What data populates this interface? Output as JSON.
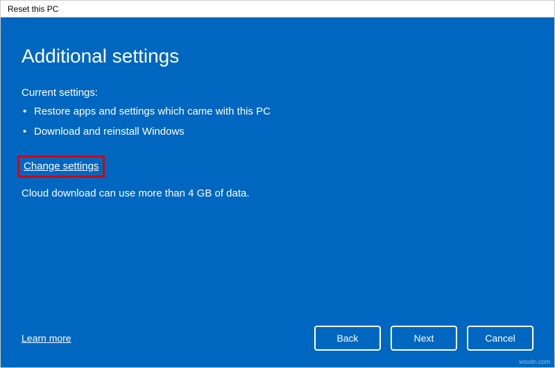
{
  "window": {
    "title": "Reset this PC"
  },
  "page": {
    "heading": "Additional settings",
    "current_settings_label": "Current settings:",
    "bullets": [
      "Restore apps and settings which came with this PC",
      "Download and reinstall Windows"
    ],
    "change_settings_link": "Change settings",
    "note": "Cloud download can use more than 4 GB of data."
  },
  "footer": {
    "learn_more": "Learn more",
    "buttons": {
      "back": "Back",
      "next": "Next",
      "cancel": "Cancel"
    }
  },
  "watermark": "wsxdn.com"
}
